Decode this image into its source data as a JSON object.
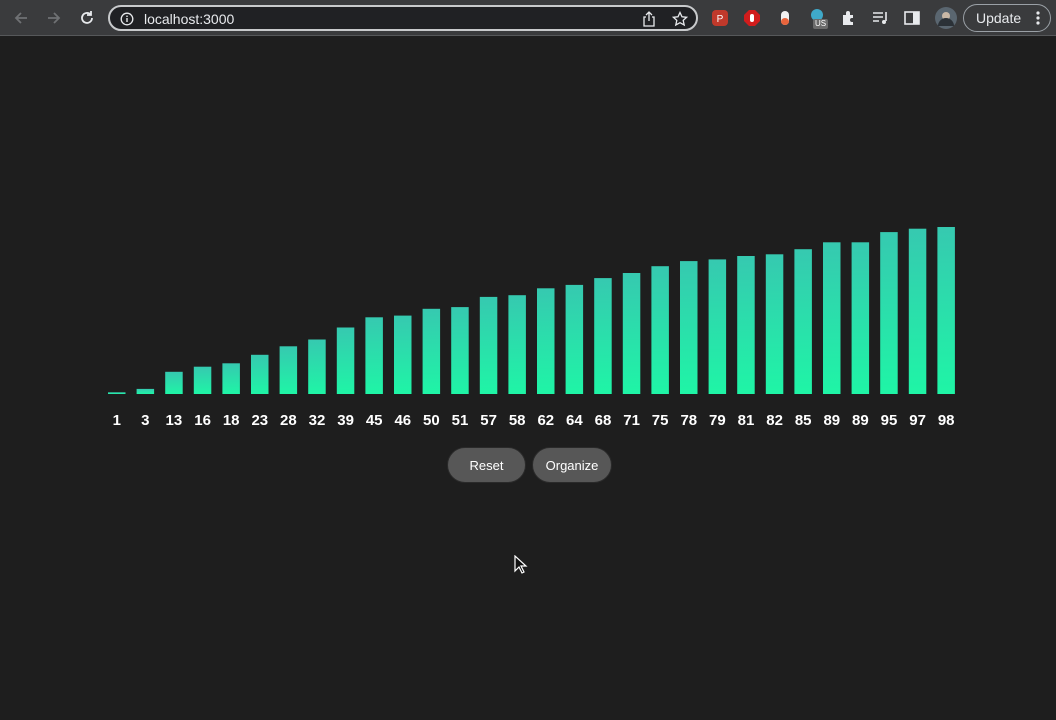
{
  "browser": {
    "url": "localhost:3000",
    "update_label": "Update",
    "ext_badge": "US",
    "icons": [
      "back-arrow-icon",
      "forward-arrow-icon",
      "reload-icon",
      "info-icon",
      "share-icon",
      "star-icon",
      "puzzle-icon",
      "reading-list-icon",
      "side-panel-icon",
      "profile-avatar",
      "more-vertical-icon"
    ]
  },
  "controls": {
    "reset_label": "Reset",
    "organize_label": "Organize"
  },
  "colors": {
    "bar_top": "#36c9b0",
    "bar_bottom": "#1ff5a6",
    "background": "#1e1e1e",
    "button_bg": "#575757"
  },
  "chart_data": {
    "type": "bar",
    "categories": [
      "1",
      "3",
      "13",
      "16",
      "18",
      "23",
      "28",
      "32",
      "39",
      "45",
      "46",
      "50",
      "51",
      "57",
      "58",
      "62",
      "64",
      "68",
      "71",
      "75",
      "78",
      "79",
      "81",
      "82",
      "85",
      "89",
      "89",
      "95",
      "97",
      "98"
    ],
    "values": [
      1,
      3,
      13,
      16,
      18,
      23,
      28,
      32,
      39,
      45,
      46,
      50,
      51,
      57,
      58,
      62,
      64,
      68,
      71,
      75,
      78,
      79,
      81,
      82,
      85,
      89,
      89,
      95,
      97,
      98
    ],
    "ylim": [
      0,
      98
    ],
    "grid": false
  }
}
